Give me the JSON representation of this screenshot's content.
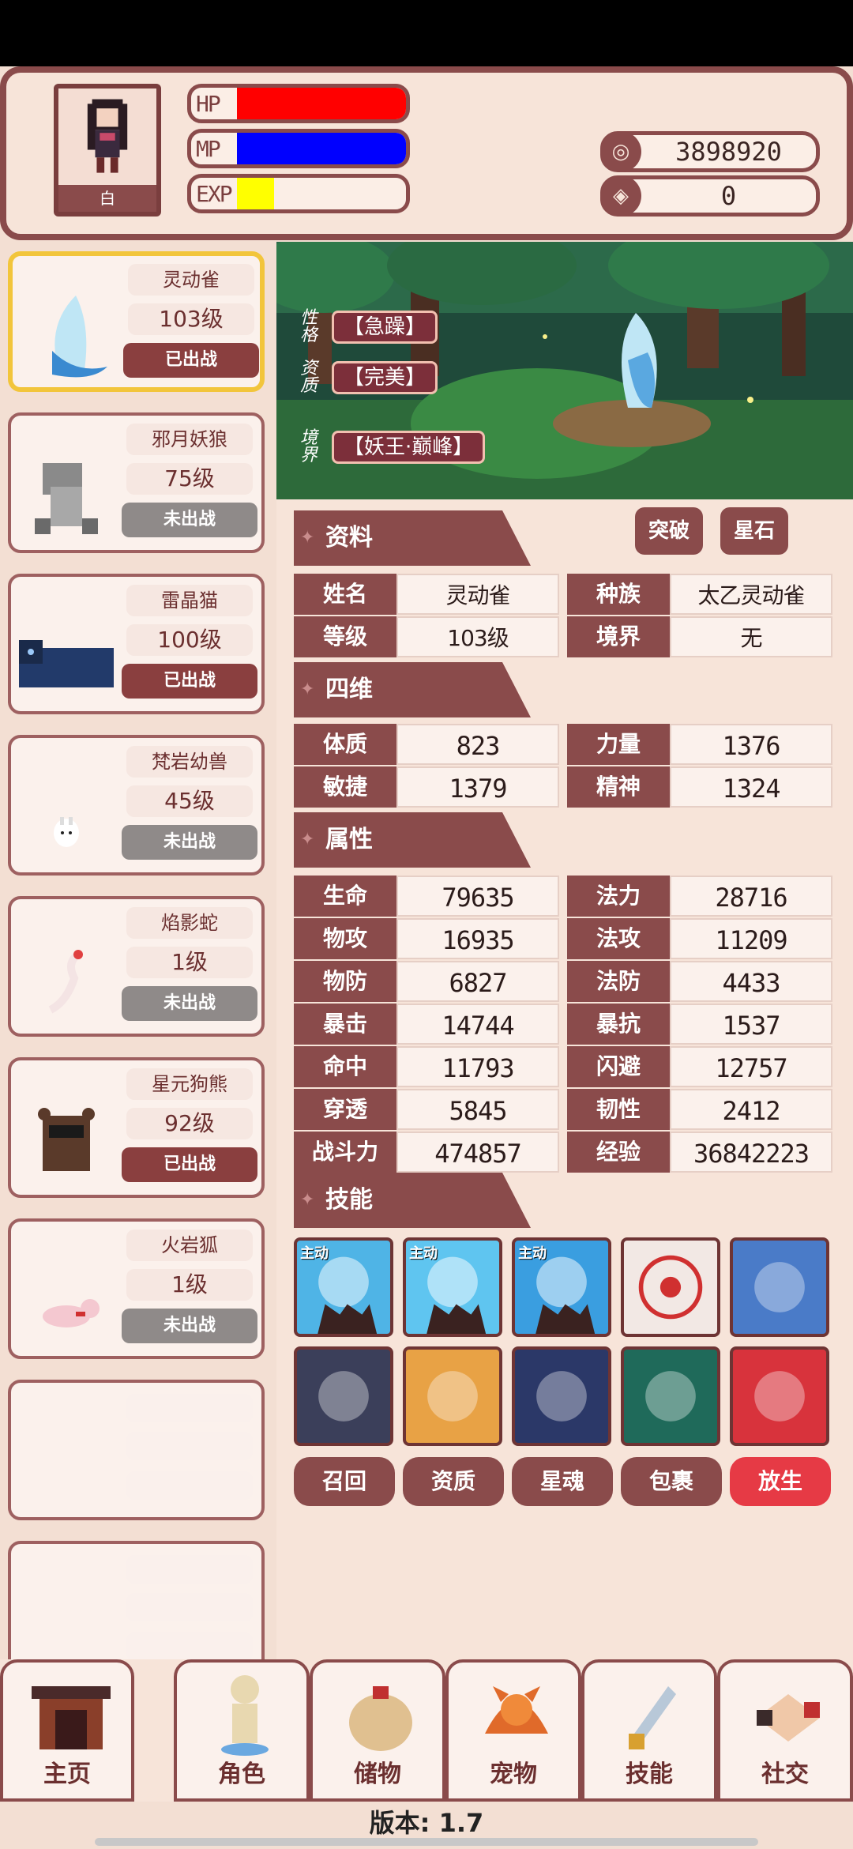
{
  "header": {
    "avatar_label": "白",
    "bars": [
      {
        "label": "HP",
        "fill": 1.0,
        "color": "#ff0000"
      },
      {
        "label": "MP",
        "fill": 1.0,
        "color": "#0000ff"
      },
      {
        "label": "EXP",
        "fill": 0.22,
        "color": "#ffff00"
      }
    ],
    "currency": [
      {
        "icon": "coin-icon",
        "glyph": "◎",
        "value": "3898920"
      },
      {
        "icon": "gem-icon",
        "glyph": "◈",
        "value": "0"
      }
    ]
  },
  "pets": [
    {
      "name": "灵动雀",
      "level": "103级",
      "status": "已出战",
      "fighting": true,
      "active": true
    },
    {
      "name": "邪月妖狼",
      "level": "75级",
      "status": "未出战",
      "fighting": false
    },
    {
      "name": "雷晶猫",
      "level": "100级",
      "status": "已出战",
      "fighting": true
    },
    {
      "name": "梵岩幼兽",
      "level": "45级",
      "status": "未出战",
      "fighting": false
    },
    {
      "name": "焰影蛇",
      "level": "1级",
      "status": "未出战",
      "fighting": false
    },
    {
      "name": "星元狗熊",
      "level": "92级",
      "status": "已出战",
      "fighting": true
    },
    {
      "name": "火岩狐",
      "level": "1级",
      "status": "未出战",
      "fighting": false
    }
  ],
  "scene": {
    "traits": [
      {
        "key": "性格",
        "value": "【急躁】"
      },
      {
        "key": "资质",
        "value": "【完美】"
      },
      {
        "key": "境界",
        "value": "【妖王·巅峰】"
      }
    ]
  },
  "panel": {
    "sections": {
      "info": "资料",
      "four": "四维",
      "attr": "属性",
      "skills": "技能"
    },
    "buttons": {
      "breakthrough": "突破",
      "starstone": "星石"
    },
    "info_rows": [
      [
        {
          "k": "姓名",
          "v": "灵动雀"
        },
        {
          "k": "种族",
          "v": "太乙灵动雀"
        }
      ],
      [
        {
          "k": "等级",
          "v": "103级"
        },
        {
          "k": "境界",
          "v": "无"
        }
      ]
    ],
    "four_rows": [
      [
        {
          "k": "体质",
          "v": "823"
        },
        {
          "k": "力量",
          "v": "1376"
        }
      ],
      [
        {
          "k": "敏捷",
          "v": "1379"
        },
        {
          "k": "精神",
          "v": "1324"
        }
      ]
    ],
    "attr_rows": [
      [
        {
          "k": "生命",
          "v": "79635"
        },
        {
          "k": "法力",
          "v": "28716"
        }
      ],
      [
        {
          "k": "物攻",
          "v": "16935"
        },
        {
          "k": "法攻",
          "v": "11209"
        }
      ],
      [
        {
          "k": "物防",
          "v": "6827"
        },
        {
          "k": "法防",
          "v": "4433"
        }
      ],
      [
        {
          "k": "暴击",
          "v": "14744"
        },
        {
          "k": "暴抗",
          "v": "1537"
        }
      ],
      [
        {
          "k": "命中",
          "v": "11793"
        },
        {
          "k": "闪避",
          "v": "12757"
        }
      ],
      [
        {
          "k": "穿透",
          "v": "5845"
        },
        {
          "k": "韧性",
          "v": "2412"
        }
      ],
      [
        {
          "k": "战斗力",
          "v": "474857"
        },
        {
          "k": "经验",
          "v": "36842223"
        }
      ]
    ],
    "skill_tag": "主动",
    "skills": [
      {
        "name": "ice-burst-skill-icon",
        "active": true,
        "color": "#4fb4e6"
      },
      {
        "name": "frost-claw-skill-icon",
        "active": true,
        "color": "#5fc5f0"
      },
      {
        "name": "ice-pillar-skill-icon",
        "active": true,
        "color": "#3a9ee0"
      },
      {
        "name": "target-skill-icon",
        "active": false,
        "color": "#f2e8e4"
      },
      {
        "name": "ghost-dash-skill-icon",
        "active": false,
        "color": "#4a7bc8"
      },
      {
        "name": "lightning-skill-icon",
        "active": false,
        "color": "#3b3f5a"
      },
      {
        "name": "muscle-skill-icon",
        "active": false,
        "color": "#e8a245"
      },
      {
        "name": "brain-skill-icon",
        "active": false,
        "color": "#2b3868"
      },
      {
        "name": "spirit-skill-icon",
        "active": false,
        "color": "#1f6a5a"
      },
      {
        "name": "fist-skill-icon",
        "active": false,
        "color": "#d8333c"
      }
    ],
    "actions": [
      {
        "label": "召回",
        "danger": false
      },
      {
        "label": "资质",
        "danger": false
      },
      {
        "label": "星魂",
        "danger": false
      },
      {
        "label": "包裹",
        "danger": false
      },
      {
        "label": "放生",
        "danger": true
      }
    ]
  },
  "nav": [
    {
      "label": "主页",
      "icon": "gate-icon"
    },
    {
      "label": "角色",
      "icon": "character-icon"
    },
    {
      "label": "储物",
      "icon": "bag-icon"
    },
    {
      "label": "宠物",
      "icon": "fox-icon"
    },
    {
      "label": "技能",
      "icon": "sword-icon"
    },
    {
      "label": "社交",
      "icon": "handshake-icon"
    }
  ],
  "version": "版本: 1.7"
}
